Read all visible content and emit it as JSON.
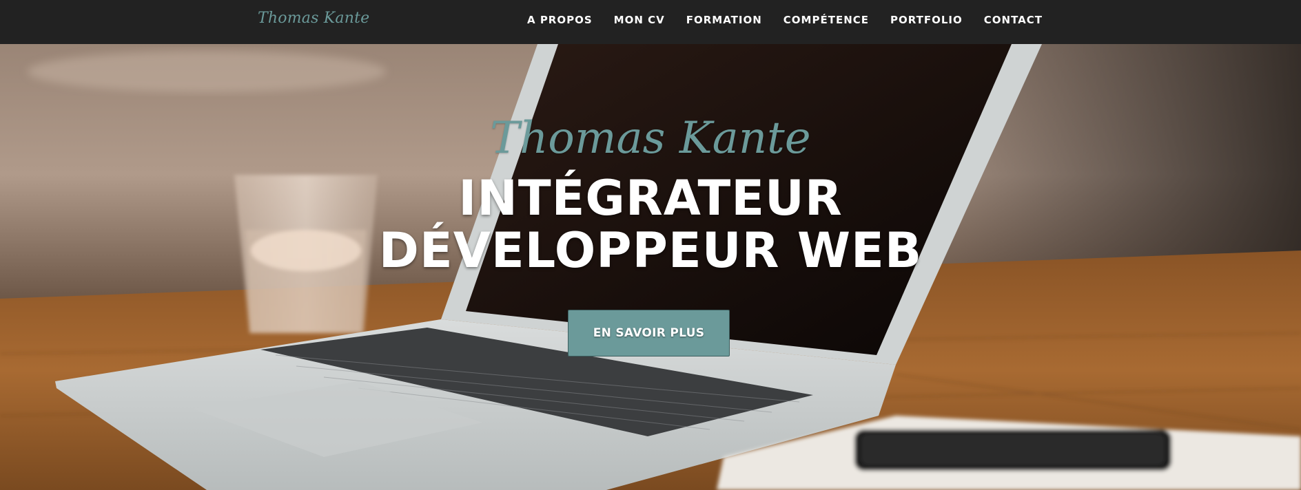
{
  "navbar": {
    "brand": "Thomas Kante",
    "items": [
      {
        "label": "A PROPOS"
      },
      {
        "label": "MON CV"
      },
      {
        "label": "FORMATION"
      },
      {
        "label": "COMPÉTENCE"
      },
      {
        "label": "PORTFOLIO"
      },
      {
        "label": "CONTACT"
      }
    ]
  },
  "hero": {
    "name": "Thomas Kante",
    "title_line1": "INTÉGRATEUR",
    "title_line2": "DÉVELOPPEUR WEB",
    "cta_label": "EN SAVOIR PLUS",
    "background_image": "laptop-on-wooden-desk-photo"
  },
  "colors": {
    "accent": "#6b9a9a",
    "navbar_bg": "#222222",
    "text_light": "#ffffff"
  }
}
